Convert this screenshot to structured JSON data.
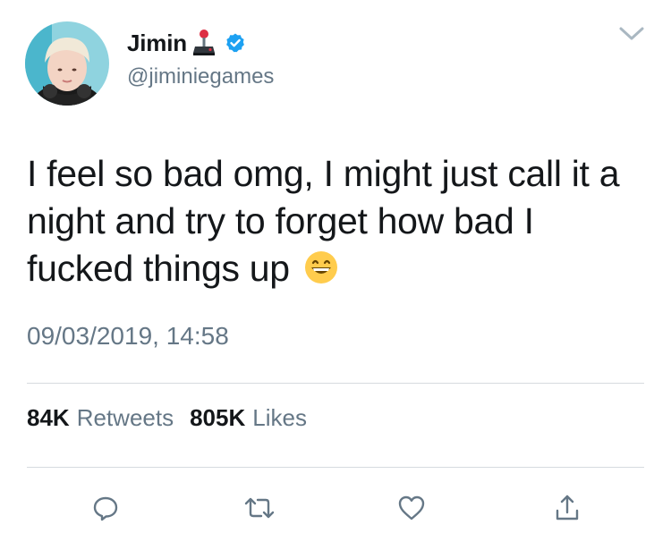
{
  "user": {
    "display_name": "Jimin",
    "handle": "@jiminiegames",
    "verified": true,
    "name_emoji": "joystick-icon"
  },
  "tweet": {
    "text": "I feel so bad omg, I might just call it a night and try to forget how bad I fucked things up",
    "emoji": "grinning-face-icon",
    "timestamp": "09/03/2019, 14:58"
  },
  "stats": {
    "retweets_count": "84K",
    "retweets_label": "Retweets",
    "likes_count": "805K",
    "likes_label": "Likes"
  },
  "colors": {
    "text": "#14171a",
    "secondary": "#657786",
    "verified_blue": "#1da1f2",
    "icon_gray": "#657786",
    "divider": "#d6dbdf"
  },
  "actions": [
    "reply-icon",
    "retweet-icon",
    "like-icon",
    "share-icon"
  ]
}
